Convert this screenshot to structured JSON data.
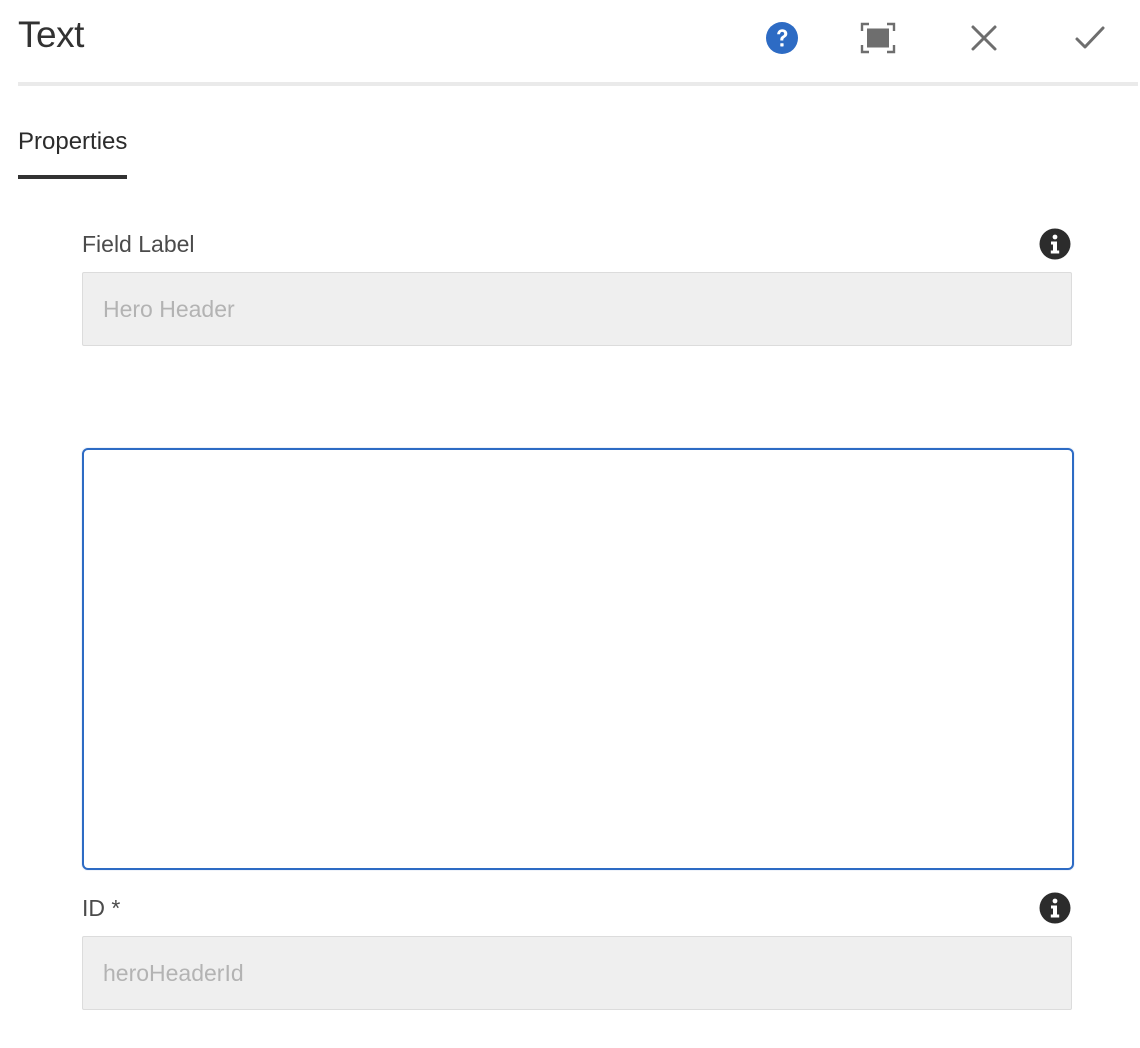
{
  "dialog": {
    "title": "Text",
    "icons": {
      "help": "help-icon",
      "fullscreen": "fullscreen-icon",
      "close": "close-icon",
      "done": "checkmark-icon"
    }
  },
  "tabs": [
    {
      "label": "Properties",
      "selected": true
    }
  ],
  "fields": {
    "field_label": {
      "label": "Field Label",
      "value": "Hero Header",
      "disabled": true
    },
    "text": {
      "value": ""
    },
    "id": {
      "label": "ID *",
      "value": "heroHeaderId",
      "disabled": true
    }
  },
  "colors": {
    "accent": "#2D6BC4",
    "help_icon": "#2D6BC4",
    "disabled_field_bg": "#EFEFEF"
  }
}
